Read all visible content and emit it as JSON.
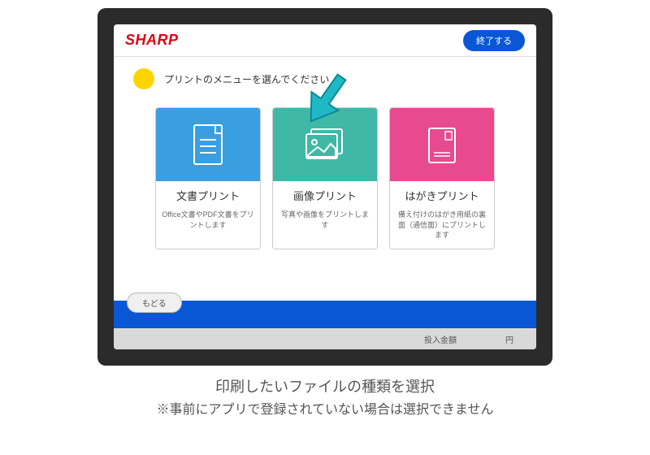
{
  "header": {
    "brand": "SHARP",
    "exit_label": "終了する"
  },
  "instruction": "プリントのメニューを選んでください",
  "cards": [
    {
      "title": "文書プリント",
      "desc": "Office文書やPDF文書をプリントします"
    },
    {
      "title": "画像プリント",
      "desc": "写真や画像をプリントします"
    },
    {
      "title": "はがきプリント",
      "desc": "備え付けのはがき用紙の裏面（通信面）にプリントします"
    }
  ],
  "footer": {
    "back_label": "もどる",
    "deposit_label": "投入金額",
    "currency": "円"
  },
  "caption": {
    "line1": "印刷したいファイルの種類を選択",
    "line2": "※事前にアプリで登録されていない場合は選択できません"
  }
}
